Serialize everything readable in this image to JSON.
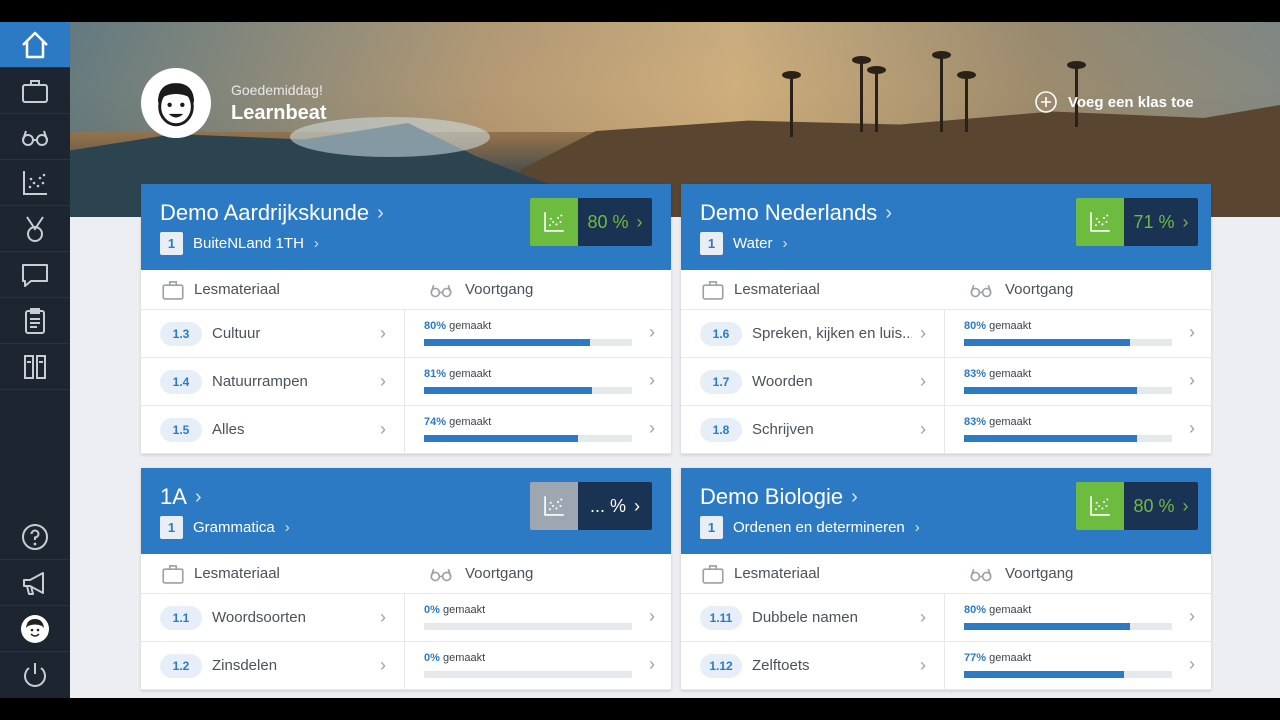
{
  "header": {
    "greeting": "Goedemiddag!",
    "username": "Learnbeat",
    "add_class_label": "Voeg een klas toe"
  },
  "sidebar": {
    "items": [
      {
        "icon": "home-icon",
        "active": true
      },
      {
        "icon": "briefcase-icon"
      },
      {
        "icon": "glasses-icon"
      },
      {
        "icon": "scatter-chart-icon"
      },
      {
        "icon": "medal-icon"
      },
      {
        "icon": "chat-icon"
      },
      {
        "icon": "clipboard-icon"
      },
      {
        "icon": "notebook-icon"
      }
    ],
    "bottom": [
      {
        "icon": "help-icon"
      },
      {
        "icon": "megaphone-icon"
      },
      {
        "icon": "avatar-icon"
      },
      {
        "icon": "power-icon"
      }
    ]
  },
  "labels": {
    "lesmateriaal": "Lesmateriaal",
    "voortgang": "Voortgang",
    "gemaakt": "gemaakt"
  },
  "cards": [
    {
      "title": "Demo Aardrijkskunde",
      "sub_num": "1",
      "sub_name": "BuiteNLand 1TH",
      "score": "80 %",
      "score_active": true,
      "rows": [
        {
          "num": "1.3",
          "name": "Cultuur",
          "pct_label": "80%",
          "pct": 80
        },
        {
          "num": "1.4",
          "name": "Natuurrampen",
          "pct_label": "81%",
          "pct": 81
        },
        {
          "num": "1.5",
          "name": "Alles",
          "pct_label": "74%",
          "pct": 74
        }
      ]
    },
    {
      "title": "Demo Nederlands",
      "sub_num": "1",
      "sub_name": "Water",
      "score": "71 %",
      "score_active": true,
      "rows": [
        {
          "num": "1.6",
          "name": "Spreken, kijken en luis...",
          "pct_label": "80%",
          "pct": 80
        },
        {
          "num": "1.7",
          "name": "Woorden",
          "pct_label": "83%",
          "pct": 83
        },
        {
          "num": "1.8",
          "name": "Schrijven",
          "pct_label": "83%",
          "pct": 83
        }
      ]
    },
    {
      "title": "1A",
      "sub_num": "1",
      "sub_name": "Grammatica",
      "score": "... %",
      "score_active": false,
      "rows": [
        {
          "num": "1.1",
          "name": "Woordsoorten",
          "pct_label": "0%",
          "pct": 0
        },
        {
          "num": "1.2",
          "name": "Zinsdelen",
          "pct_label": "0%",
          "pct": 0
        }
      ]
    },
    {
      "title": "Demo Biologie",
      "sub_num": "1",
      "sub_name": "Ordenen en determineren",
      "score": "80 %",
      "score_active": true,
      "rows": [
        {
          "num": "1.11",
          "name": "Dubbele namen",
          "pct_label": "80%",
          "pct": 80
        },
        {
          "num": "1.12",
          "name": "Zelftoets",
          "pct_label": "77%",
          "pct": 77
        }
      ]
    }
  ],
  "colors": {
    "primary": "#2d7ac4",
    "score_green": "#6dbb3f",
    "score_dark": "#1b3352",
    "sidebar": "#1c2530"
  }
}
